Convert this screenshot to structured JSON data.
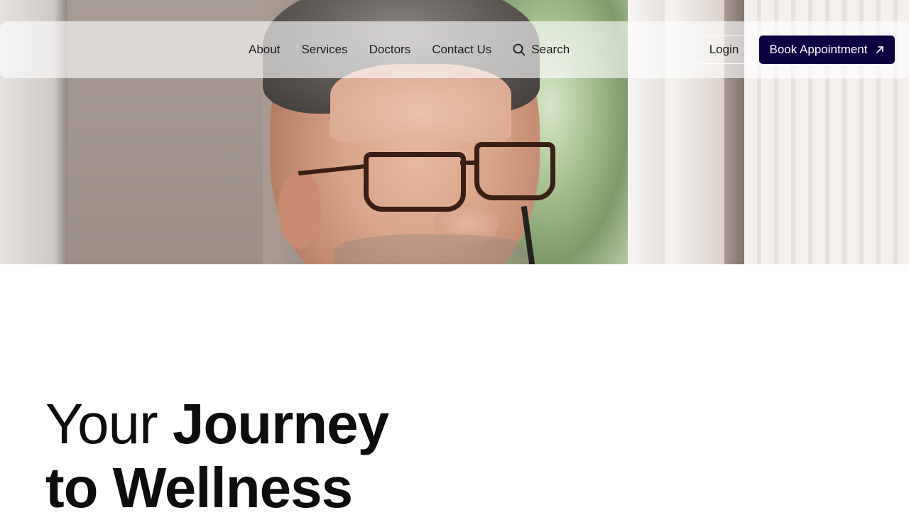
{
  "nav": {
    "links": [
      "About",
      "Services",
      "Doctors",
      "Contact Us"
    ],
    "search_label": "Search",
    "search_icon": "search-icon",
    "login_label": "Login",
    "cta_label": "Book Appointment",
    "cta_icon": "arrow-up-right-icon"
  },
  "hero": {
    "image": "man-with-glasses-photo"
  },
  "headline": {
    "line1_light": "Your",
    "line1_bold": "Journey",
    "line2_bold": "to Wellness"
  },
  "colors": {
    "cta_background": "#0b0340",
    "cta_text": "#ffffff",
    "text": "#0d0d0d"
  }
}
